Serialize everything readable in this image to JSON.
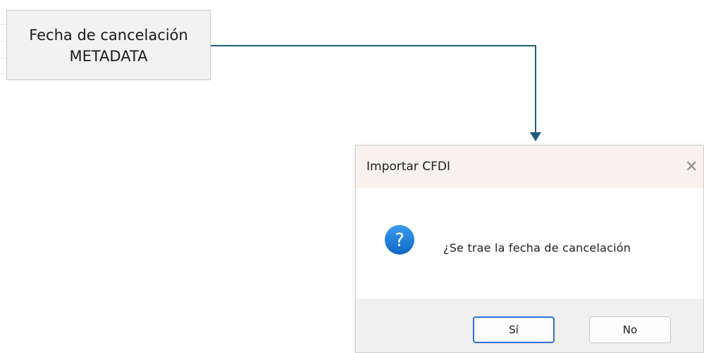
{
  "header_cell": {
    "line1": "Fecha de cancelación",
    "line2": "METADATA"
  },
  "connector": {
    "color": "#1f5c7a"
  },
  "dialog": {
    "title": "Importar CFDI",
    "close_icon": "close-icon",
    "message": "¿Se trae la fecha de cancelación",
    "question_icon": "question-icon",
    "accent": "#1c7fd6",
    "buttons": {
      "yes_label": "Sí",
      "no_label": "No"
    }
  }
}
